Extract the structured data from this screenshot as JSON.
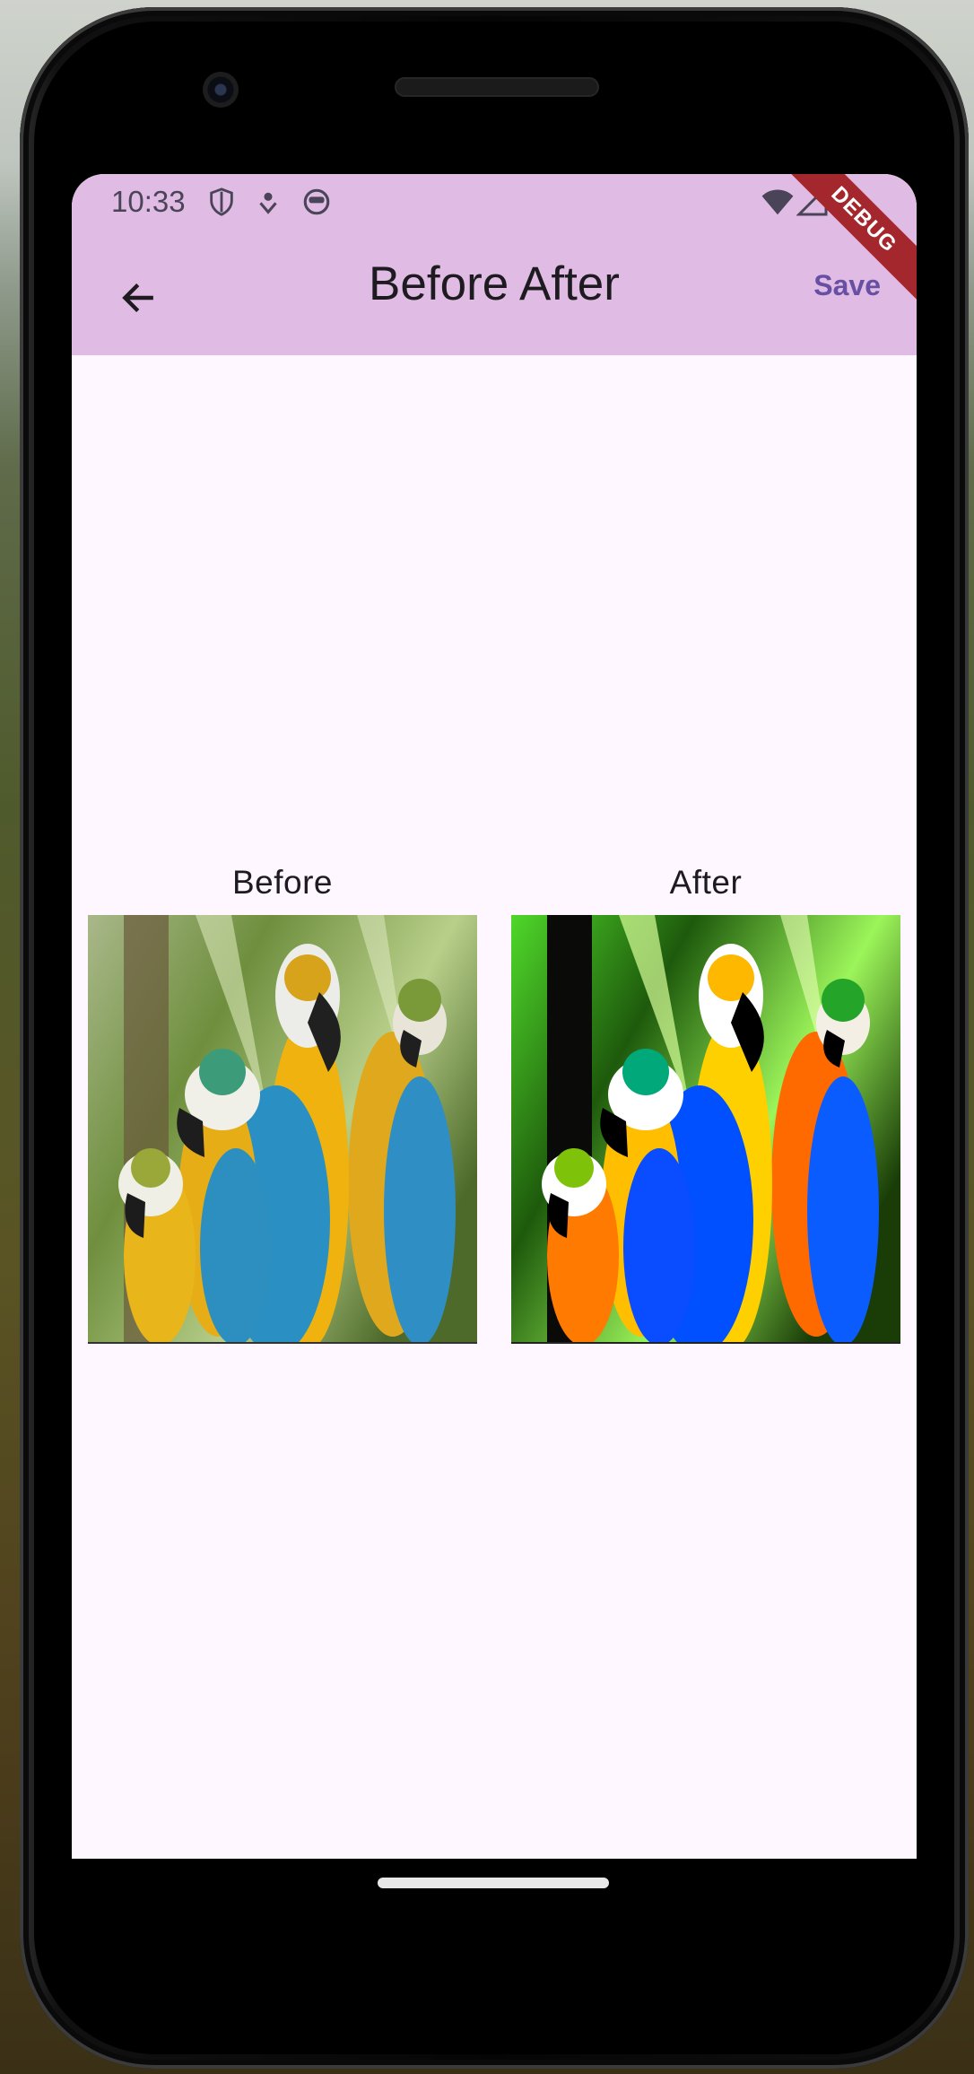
{
  "status_bar": {
    "time": "10:33",
    "left_icons": [
      "shield-icon",
      "location-dot-icon",
      "face-icon"
    ],
    "right_icons": [
      "wifi-icon",
      "signal-icon",
      "battery-icon"
    ]
  },
  "debug_banner": "DEBUG",
  "appbar": {
    "title": "Before After",
    "save_label": "Save",
    "back_icon": "arrow-back-icon",
    "background": "#e0bbe4",
    "accent": "#6750a4"
  },
  "comparison": {
    "before_label": "Before",
    "after_label": "After"
  }
}
